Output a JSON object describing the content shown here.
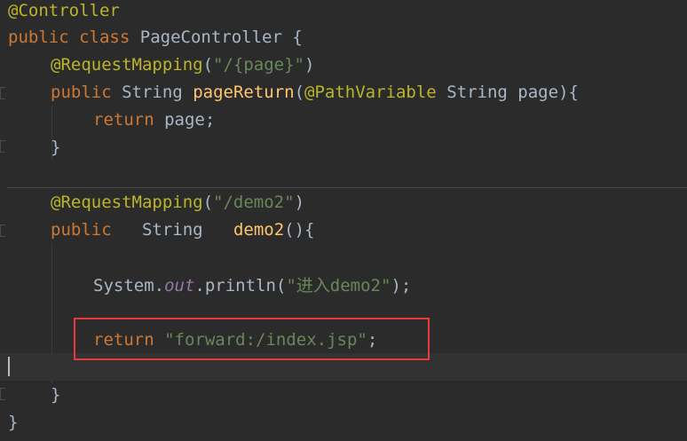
{
  "code": {
    "l1": {
      "annotation": "@Controller"
    },
    "l2": {
      "kw1": "public",
      "kw2": "class",
      "class_name": "PageController",
      "brace": "{"
    },
    "l3": {
      "annotation": "@RequestMapping",
      "open": "(",
      "string": "\"/{page}\"",
      "close": ")"
    },
    "l4": {
      "kw": "public",
      "type": "String",
      "method": "pageReturn",
      "open": "(",
      "param_ann": "@PathVariable",
      "param_type": "String",
      "param_name": "page",
      "close": "){"
    },
    "l5": {
      "kw": "return",
      "value": "page;"
    },
    "l6": {
      "brace": "}"
    },
    "l7": {
      "annotation": "@RequestMapping",
      "open": "(",
      "string": "\"/demo2\"",
      "close": ")"
    },
    "l8": {
      "kw": "public",
      "type": "String",
      "method": "demo2",
      "parens": "(){"
    },
    "l9": {
      "obj": "System.",
      "field": "out",
      "call": ".println(",
      "string": "\"进入demo2\"",
      "end": ");"
    },
    "l10": {
      "kw": "return",
      "string": "\"forward:/index.jsp\"",
      "end": ";"
    },
    "l11": {
      "brace": "}"
    },
    "l12": {
      "brace": "}"
    }
  },
  "colors": {
    "background": "#2b2b2b",
    "annotation": "#bbb529",
    "keyword": "#cc7832",
    "string": "#6a8759",
    "method": "#ffc66d",
    "text": "#a9b7c6",
    "highlight_border": "#e53b3b"
  }
}
